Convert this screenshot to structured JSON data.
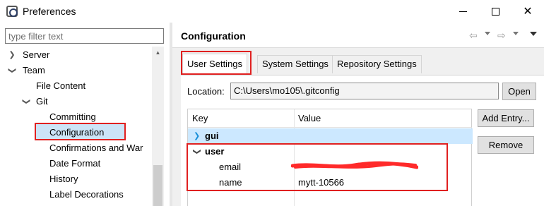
{
  "window": {
    "title": "Preferences"
  },
  "left_panel": {
    "filter_placeholder": "type filter text",
    "tree": [
      {
        "label": "Server",
        "expanded": false
      },
      {
        "label": "Team",
        "expanded": true
      },
      {
        "label": "File Content"
      },
      {
        "label": "Git",
        "expanded": true
      },
      {
        "label": "Committing"
      },
      {
        "label": "Configuration",
        "selected": true
      },
      {
        "label": "Confirmations and War"
      },
      {
        "label": "Date Format"
      },
      {
        "label": "History"
      },
      {
        "label": "Label Decorations"
      }
    ]
  },
  "right_panel": {
    "title": "Configuration",
    "tabs": [
      {
        "label": "User Settings",
        "active": true
      },
      {
        "label": "System Settings"
      },
      {
        "label": "Repository Settings"
      }
    ],
    "location_label": "Location:",
    "location_value": "C:\\Users\\mo105\\.gitconfig",
    "open_button": "Open",
    "table": {
      "headers": [
        "Key",
        "Value"
      ],
      "rows": [
        {
          "key": "gui",
          "value": "",
          "level": 0,
          "expanded": false
        },
        {
          "key": "user",
          "value": "",
          "level": 0,
          "expanded": true
        },
        {
          "key": "email",
          "value": "",
          "level": 1
        },
        {
          "key": "name",
          "value": "mytt-10566",
          "level": 1
        }
      ]
    },
    "add_entry_button": "Add Entry...",
    "remove_button": "Remove"
  },
  "colors": {
    "selection": "#cce4f7",
    "annotation_red": "#e02020"
  }
}
